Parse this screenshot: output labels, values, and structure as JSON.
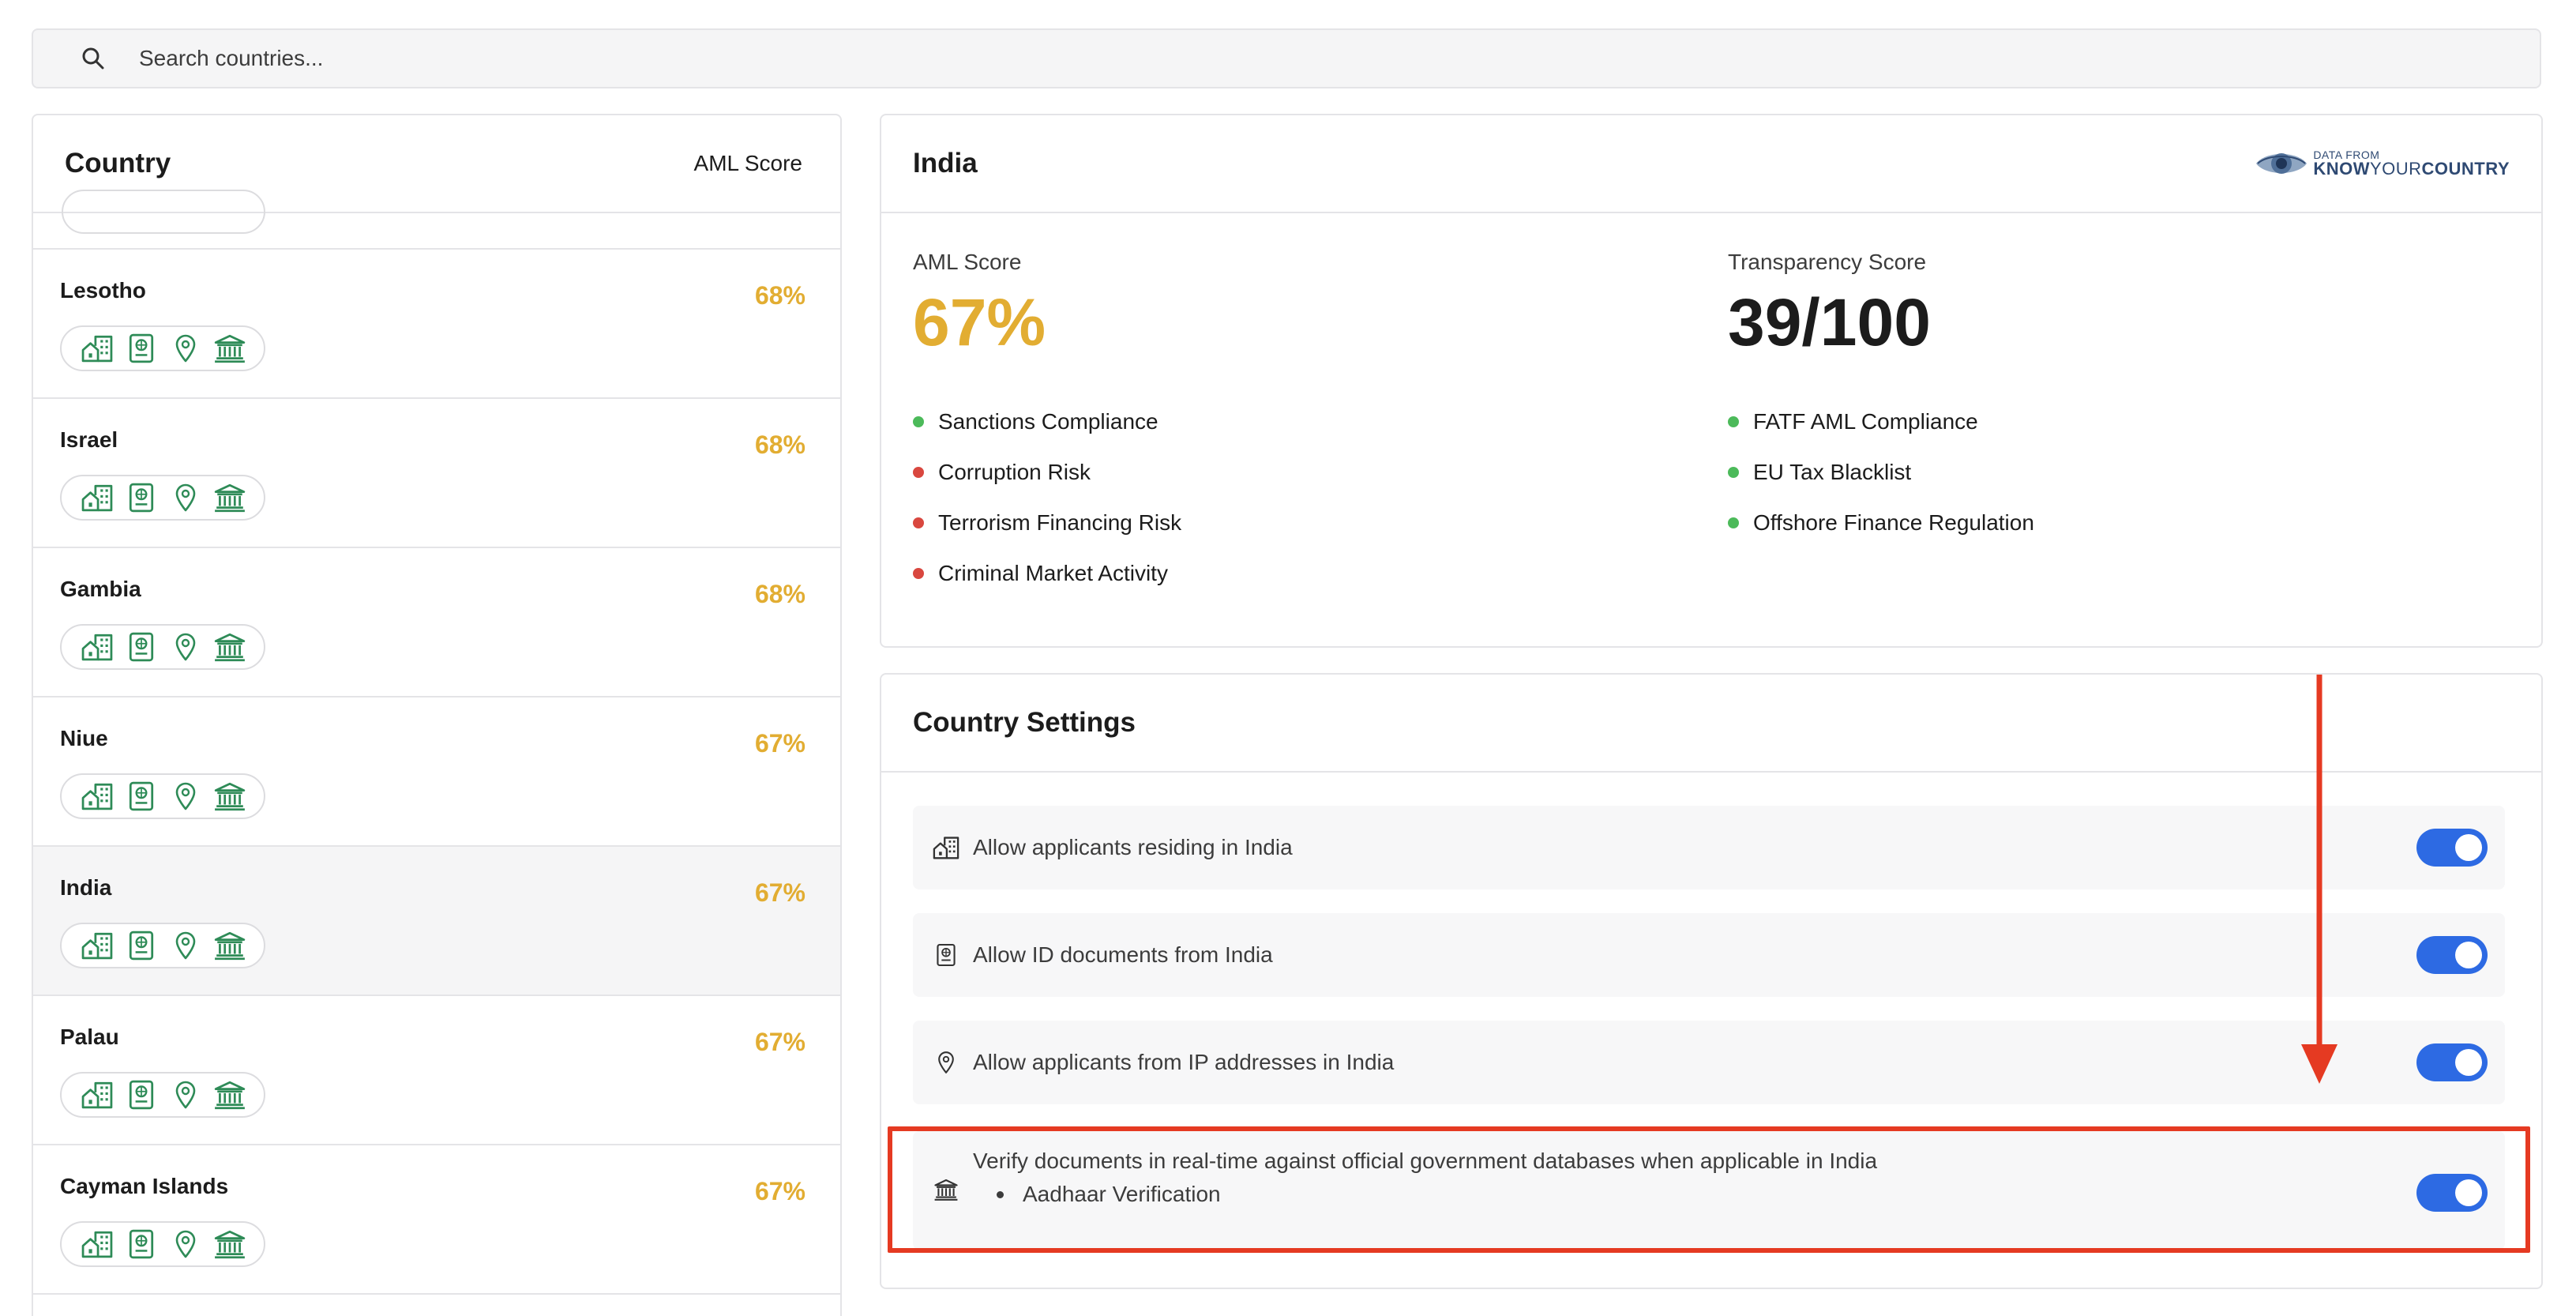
{
  "search": {
    "placeholder": "Search countries...",
    "icon": "search-icon"
  },
  "country_list": {
    "header": {
      "title": "Country",
      "score_label": "AML Score"
    },
    "row_icons": [
      "residence-icon",
      "id-document-icon",
      "location-pin-icon",
      "government-building-icon"
    ],
    "rows": [
      {
        "name": "Lesotho",
        "score": "68%"
      },
      {
        "name": "Israel",
        "score": "68%"
      },
      {
        "name": "Gambia",
        "score": "68%"
      },
      {
        "name": "Niue",
        "score": "67%"
      },
      {
        "name": "India",
        "score": "67%",
        "selected": true
      },
      {
        "name": "Palau",
        "score": "67%"
      },
      {
        "name": "Cayman Islands",
        "score": "67%"
      }
    ]
  },
  "detail": {
    "country": "India",
    "source_logo": {
      "small": "DATA FROM",
      "know": "KNOW",
      "your": "YOUR",
      "country": "COUNTRY"
    },
    "aml": {
      "label": "AML Score",
      "value": "67%"
    },
    "transparency": {
      "label": "Transparency Score",
      "value": "39/100"
    },
    "indicators_left": [
      {
        "label": "Sanctions Compliance",
        "status": "green"
      },
      {
        "label": "Corruption Risk",
        "status": "red"
      },
      {
        "label": "Terrorism Financing Risk",
        "status": "red"
      },
      {
        "label": "Criminal Market Activity",
        "status": "red"
      }
    ],
    "indicators_right": [
      {
        "label": "FATF AML Compliance",
        "status": "green"
      },
      {
        "label": "EU Tax Blacklist",
        "status": "green"
      },
      {
        "label": "Offshore Finance Regulation",
        "status": "green"
      }
    ]
  },
  "settings": {
    "title": "Country Settings",
    "items": [
      {
        "icon": "residence-icon",
        "label": "Allow applicants residing in India",
        "enabled": true
      },
      {
        "icon": "id-document-icon",
        "label": "Allow ID documents from India",
        "enabled": true
      },
      {
        "icon": "location-pin-icon",
        "label": "Allow applicants from IP addresses in India",
        "enabled": true
      },
      {
        "icon": "government-building-icon",
        "label": "Verify documents in real-time against official government databases when applicable in India",
        "sub_items": [
          "Aadhaar Verification"
        ],
        "enabled": true
      }
    ]
  },
  "colors": {
    "score_amber": "#e2ad32",
    "toggle_blue": "#2d6ae3",
    "status_green": "#4cba5a",
    "status_red": "#d9473f",
    "icon_green": "#2e8b57",
    "annotation_red": "#e53a22"
  }
}
